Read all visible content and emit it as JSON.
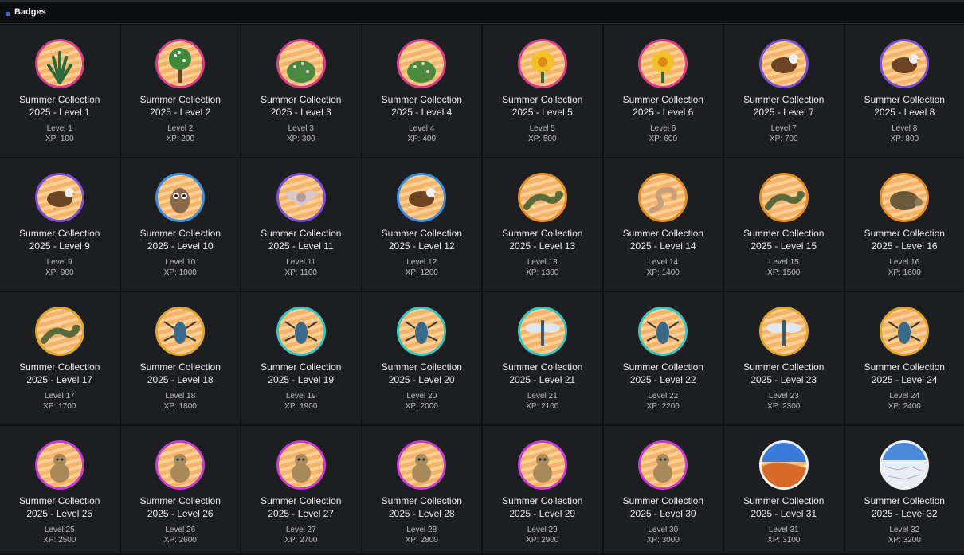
{
  "header": {
    "title": "Badges",
    "icon": "square-marker-icon"
  },
  "colors": {
    "accent": "#2b6fd6",
    "cell_bg": "#1d1e22",
    "page_bg": "#101114",
    "badge_bg": "#f6b46a"
  },
  "badges": [
    {
      "name_line1": "Summer Collection",
      "name_line2": "2025 - Level 1",
      "level": "Level 1",
      "xp": "XP: 100",
      "icon": "agave-icon",
      "ring": "#d93a8a"
    },
    {
      "name_line1": "Summer Collection",
      "name_line2": "2025 - Level 2",
      "level": "Level 2",
      "xp": "XP: 200",
      "icon": "flowering-tree-icon",
      "ring": "#d93a8a"
    },
    {
      "name_line1": "Summer Collection",
      "name_line2": "2025 - Level 3",
      "level": "Level 3",
      "xp": "XP: 300",
      "icon": "shrub-icon",
      "ring": "#d93a8a"
    },
    {
      "name_line1": "Summer Collection",
      "name_line2": "2025 - Level 4",
      "level": "Level 4",
      "xp": "XP: 400",
      "icon": "flowering-bush-icon",
      "ring": "#d93a8a"
    },
    {
      "name_line1": "Summer Collection",
      "name_line2": "2025 - Level 5",
      "level": "Level 5",
      "xp": "XP: 500",
      "icon": "yellow-flowers-icon",
      "ring": "#d93a8a"
    },
    {
      "name_line1": "Summer Collection",
      "name_line2": "2025 - Level 6",
      "level": "Level 6",
      "xp": "XP: 600",
      "icon": "cactus-flower-icon",
      "ring": "#d93a8a"
    },
    {
      "name_line1": "Summer Collection",
      "name_line2": "2025 - Level 7",
      "level": "Level 7",
      "xp": "XP: 700",
      "icon": "hawk-icon",
      "ring": "#7a4fd8"
    },
    {
      "name_line1": "Summer Collection",
      "name_line2": "2025 - Level 8",
      "level": "Level 8",
      "xp": "XP: 800",
      "icon": "roadrunner-icon",
      "ring": "#7a4fd8"
    },
    {
      "name_line1": "Summer Collection",
      "name_line2": "2025 - Level 9",
      "level": "Level 9",
      "xp": "XP: 900",
      "icon": "hummingbird-icon",
      "ring": "#7a4fd8"
    },
    {
      "name_line1": "Summer Collection",
      "name_line2": "2025 - Level 10",
      "level": "Level 10",
      "xp": "XP: 1000",
      "icon": "owl-icon",
      "ring": "#3a8fe0"
    },
    {
      "name_line1": "Summer Collection",
      "name_line2": "2025 - Level 11",
      "level": "Level 11",
      "xp": "XP: 1100",
      "icon": "bat-icon",
      "ring": "#7a4fd8"
    },
    {
      "name_line1": "Summer Collection",
      "name_line2": "2025 - Level 12",
      "level": "Level 12",
      "xp": "XP: 1200",
      "icon": "vulture-icon",
      "ring": "#3a8fe0"
    },
    {
      "name_line1": "Summer Collection",
      "name_line2": "2025 - Level 13",
      "level": "Level 13",
      "xp": "XP: 1300",
      "icon": "lizard-icon",
      "ring": "#e08a2a"
    },
    {
      "name_line1": "Summer Collection",
      "name_line2": "2025 - Level 14",
      "level": "Level 14",
      "xp": "XP: 1400",
      "icon": "snake-icon",
      "ring": "#e08a2a"
    },
    {
      "name_line1": "Summer Collection",
      "name_line2": "2025 - Level 15",
      "level": "Level 15",
      "xp": "XP: 1500",
      "icon": "gila-monster-icon",
      "ring": "#e08a2a"
    },
    {
      "name_line1": "Summer Collection",
      "name_line2": "2025 - Level 16",
      "level": "Level 16",
      "xp": "XP: 1600",
      "icon": "tortoise-icon",
      "ring": "#e08a2a"
    },
    {
      "name_line1": "Summer Collection",
      "name_line2": "2025 - Level 17",
      "level": "Level 17",
      "xp": "XP: 1700",
      "icon": "horned-lizard-icon",
      "ring": "#e0a52a"
    },
    {
      "name_line1": "Summer Collection",
      "name_line2": "2025 - Level 18",
      "level": "Level 18",
      "xp": "XP: 1800",
      "icon": "tarantula-icon",
      "ring": "#e0a52a"
    },
    {
      "name_line1": "Summer Collection",
      "name_line2": "2025 - Level 19",
      "level": "Level 19",
      "xp": "XP: 1900",
      "icon": "beetle-icon",
      "ring": "#3ac6c0"
    },
    {
      "name_line1": "Summer Collection",
      "name_line2": "2025 - Level 20",
      "level": "Level 20",
      "xp": "XP: 2000",
      "icon": "grasshopper-icon",
      "ring": "#3ac6c0"
    },
    {
      "name_line1": "Summer Collection",
      "name_line2": "2025 - Level 21",
      "level": "Level 21",
      "xp": "XP: 2100",
      "icon": "dragonfly-icon",
      "ring": "#3ac6c0"
    },
    {
      "name_line1": "Summer Collection",
      "name_line2": "2025 - Level 22",
      "level": "Level 22",
      "xp": "XP: 2200",
      "icon": "wasp-icon",
      "ring": "#3ac6c0"
    },
    {
      "name_line1": "Summer Collection",
      "name_line2": "2025 - Level 23",
      "level": "Level 23",
      "xp": "XP: 2300",
      "icon": "moth-icon",
      "ring": "#e0a52a"
    },
    {
      "name_line1": "Summer Collection",
      "name_line2": "2025 - Level 24",
      "level": "Level 24",
      "xp": "XP: 2400",
      "icon": "scorpion-icon",
      "ring": "#e0a52a"
    },
    {
      "name_line1": "Summer Collection",
      "name_line2": "2025 - Level 25",
      "level": "Level 25",
      "xp": "XP: 2500",
      "icon": "meerkat-icon",
      "ring": "#c83ad0"
    },
    {
      "name_line1": "Summer Collection",
      "name_line2": "2025 - Level 26",
      "level": "Level 26",
      "xp": "XP: 2600",
      "icon": "jackrabbit-icon",
      "ring": "#c83ad0"
    },
    {
      "name_line1": "Summer Collection",
      "name_line2": "2025 - Level 27",
      "level": "Level 27",
      "xp": "XP: 2700",
      "icon": "bighorn-sheep-icon",
      "ring": "#c83ad0"
    },
    {
      "name_line1": "Summer Collection",
      "name_line2": "2025 - Level 28",
      "level": "Level 28",
      "xp": "XP: 2800",
      "icon": "wildcat-icon",
      "ring": "#c83ad0"
    },
    {
      "name_line1": "Summer Collection",
      "name_line2": "2025 - Level 29",
      "level": "Level 29",
      "xp": "XP: 2900",
      "icon": "fennec-fox-icon",
      "ring": "#c83ad0"
    },
    {
      "name_line1": "Summer Collection",
      "name_line2": "2025 - Level 30",
      "level": "Level 30",
      "xp": "XP: 3000",
      "icon": "armadillo-icon",
      "ring": "#c83ad0"
    },
    {
      "name_line1": "Summer Collection",
      "name_line2": "2025 - Level 31",
      "level": "Level 31",
      "xp": "XP: 3100",
      "icon": "desert-dunes-icon",
      "ring": "#f0f0f0"
    },
    {
      "name_line1": "Summer Collection",
      "name_line2": "2025 - Level 32",
      "level": "Level 32",
      "xp": "XP: 3200",
      "icon": "salt-flat-icon",
      "ring": "#f0f0f0"
    }
  ]
}
